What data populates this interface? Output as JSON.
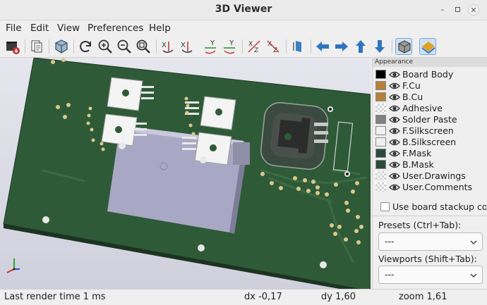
{
  "window": {
    "title": "3D Viewer"
  },
  "menu": {
    "items": [
      "File",
      "Edit",
      "View",
      "Preferences",
      "Help"
    ]
  },
  "toolbar": {
    "buttons": [
      "export-image",
      "copy-to-clipboard",
      "view-3d",
      "reload",
      "zoom-in",
      "zoom-out",
      "zoom-fit",
      "rotate-x-cw",
      "rotate-x-ccw",
      "rotate-y-cw",
      "rotate-y-ccw",
      "rotate-z-cw",
      "rotate-z-ccw",
      "flip-board",
      "move-left",
      "move-right",
      "move-up",
      "move-down",
      "toggle-orthographic",
      "toggle-raytracing"
    ],
    "texts": {
      "x": "X",
      "y": "Y",
      "z": "Z"
    }
  },
  "appearance": {
    "header": "Appearance",
    "layers": [
      {
        "name": "Board Body",
        "color": "#000000"
      },
      {
        "name": "F.Cu",
        "color": "#b8803a"
      },
      {
        "name": "B.Cu",
        "color": "#b8803a"
      },
      {
        "name": "Adhesive",
        "color": ""
      },
      {
        "name": "Solder Paste",
        "color": "#808080"
      },
      {
        "name": "F.Silkscreen",
        "color": "#f0f0f0"
      },
      {
        "name": "B.Silkscreen",
        "color": "#f0f0f0"
      },
      {
        "name": "F.Mask",
        "color": "#2a4a3a"
      },
      {
        "name": "B.Mask",
        "color": "#2a4a3a"
      },
      {
        "name": "User.Drawings",
        "color": ""
      },
      {
        "name": "User.Comments",
        "color": ""
      }
    ],
    "stackup_label": "Use board stackup colors",
    "presets_label": "Presets (Ctrl+Tab):",
    "presets_value": "---",
    "viewports_label": "Viewports (Shift+Tab):",
    "viewports_value": "---"
  },
  "status": {
    "render_time": "Last render time 1 ms",
    "dx": "dx -0,17",
    "dy": "dy 1,60",
    "zoom": "zoom 1,61"
  },
  "colors": {
    "board": "#2f5a38",
    "board_edge": "#1e3a24",
    "pad": "#d9c98a",
    "silk": "#f2f2f2",
    "accent_active": "#3b7fc4"
  }
}
